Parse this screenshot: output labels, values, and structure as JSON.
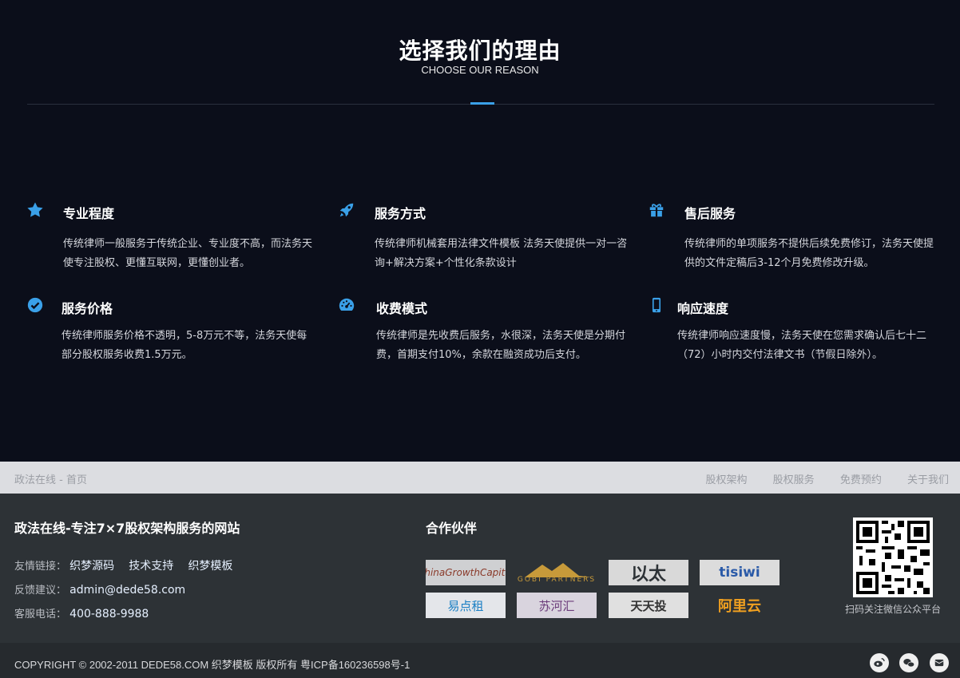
{
  "section": {
    "title": "选择我们的理由",
    "subtitle": "CHOOSE OUR REASON"
  },
  "features": [
    {
      "icon": "star-icon",
      "title": "专业程度",
      "desc": "传统律师一般服务于传统企业、专业度不高，而法务天使专注股权、更懂互联网，更懂创业者。"
    },
    {
      "icon": "rocket-icon",
      "title": "服务方式",
      "desc": "传统律师机械套用法律文件模板 法务天使提供一对一咨询+解决方案+个性化条款设计"
    },
    {
      "icon": "gift-icon",
      "title": "售后服务",
      "desc": "传统律师的单项服务不提供后续免费修订，法务天使提供的文件定稿后3-12个月免费修改升级。"
    },
    {
      "icon": "check-circle-icon",
      "title": "服务价格",
      "desc": "传统律师服务价格不透明，5-8万元不等，法务天使每部分股权服务收费1.5万元。"
    },
    {
      "icon": "dashboard-icon",
      "title": "收费模式",
      "desc": "传统律师是先收费后服务，水很深，法务天使是分期付费，首期支付10%，余款在融资成功后支付。"
    },
    {
      "icon": "mobile-icon",
      "title": "响应速度",
      "desc": "传统律师响应速度慢，法务天使在您需求确认后七十二（72）小时内交付法律文书（节假日除外）。"
    }
  ],
  "nav": {
    "breadcrumb": "政法在线 - 首页",
    "links": [
      "股权架构",
      "股权服务",
      "免费预约",
      "关于我们"
    ]
  },
  "footer": {
    "site_title": "政法在线-专注7×7股权架构服务的网站",
    "links_label": "友情链接：",
    "links": [
      "织梦源码",
      "技术支持",
      "织梦模板"
    ],
    "feedback_label": "反馈建议：",
    "feedback_email": "admin@dede58.com",
    "service_label": "客服电话：",
    "service_phone": "400-888-9988",
    "partners_title": "合作伙伴",
    "partners": [
      "ChinaGrowthCapital",
      "GOBI PARTNERS",
      "以太",
      "tisiwi",
      "易点租",
      "苏河汇",
      "天天投",
      "阿里云"
    ],
    "qr_caption": "扫码关注微信公众平台"
  },
  "copyright": "COPYRIGHT © 2002-2011 DEDE58.COM 织梦模板 版权所有 粤ICP备160236598号-1",
  "colors": {
    "accent": "#3aa0e8",
    "background": "#0b0e1a",
    "footer": "#2d3236"
  }
}
